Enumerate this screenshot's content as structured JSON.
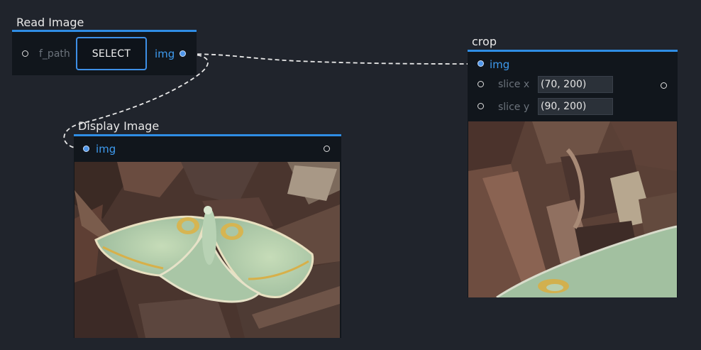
{
  "nodes": {
    "read_image": {
      "title": "Read Image",
      "input_label": "f_path",
      "button_label": "SELECT",
      "output_label": "img"
    },
    "display_image": {
      "title": "Display Image",
      "input_label": "img"
    },
    "crop": {
      "title": "crop",
      "input_label": "img",
      "slice_x_label": "slice x",
      "slice_x_value": "(70, 200)",
      "slice_y_label": "slice y",
      "slice_y_value": "(90, 200)"
    }
  },
  "colors": {
    "background": "#20242c",
    "node_body": "#11161c",
    "accent": "#2f8de4",
    "port_label": "#3e9bef"
  },
  "images": {
    "display_image": "moth-photo",
    "crop": "moth-crop-photo"
  }
}
